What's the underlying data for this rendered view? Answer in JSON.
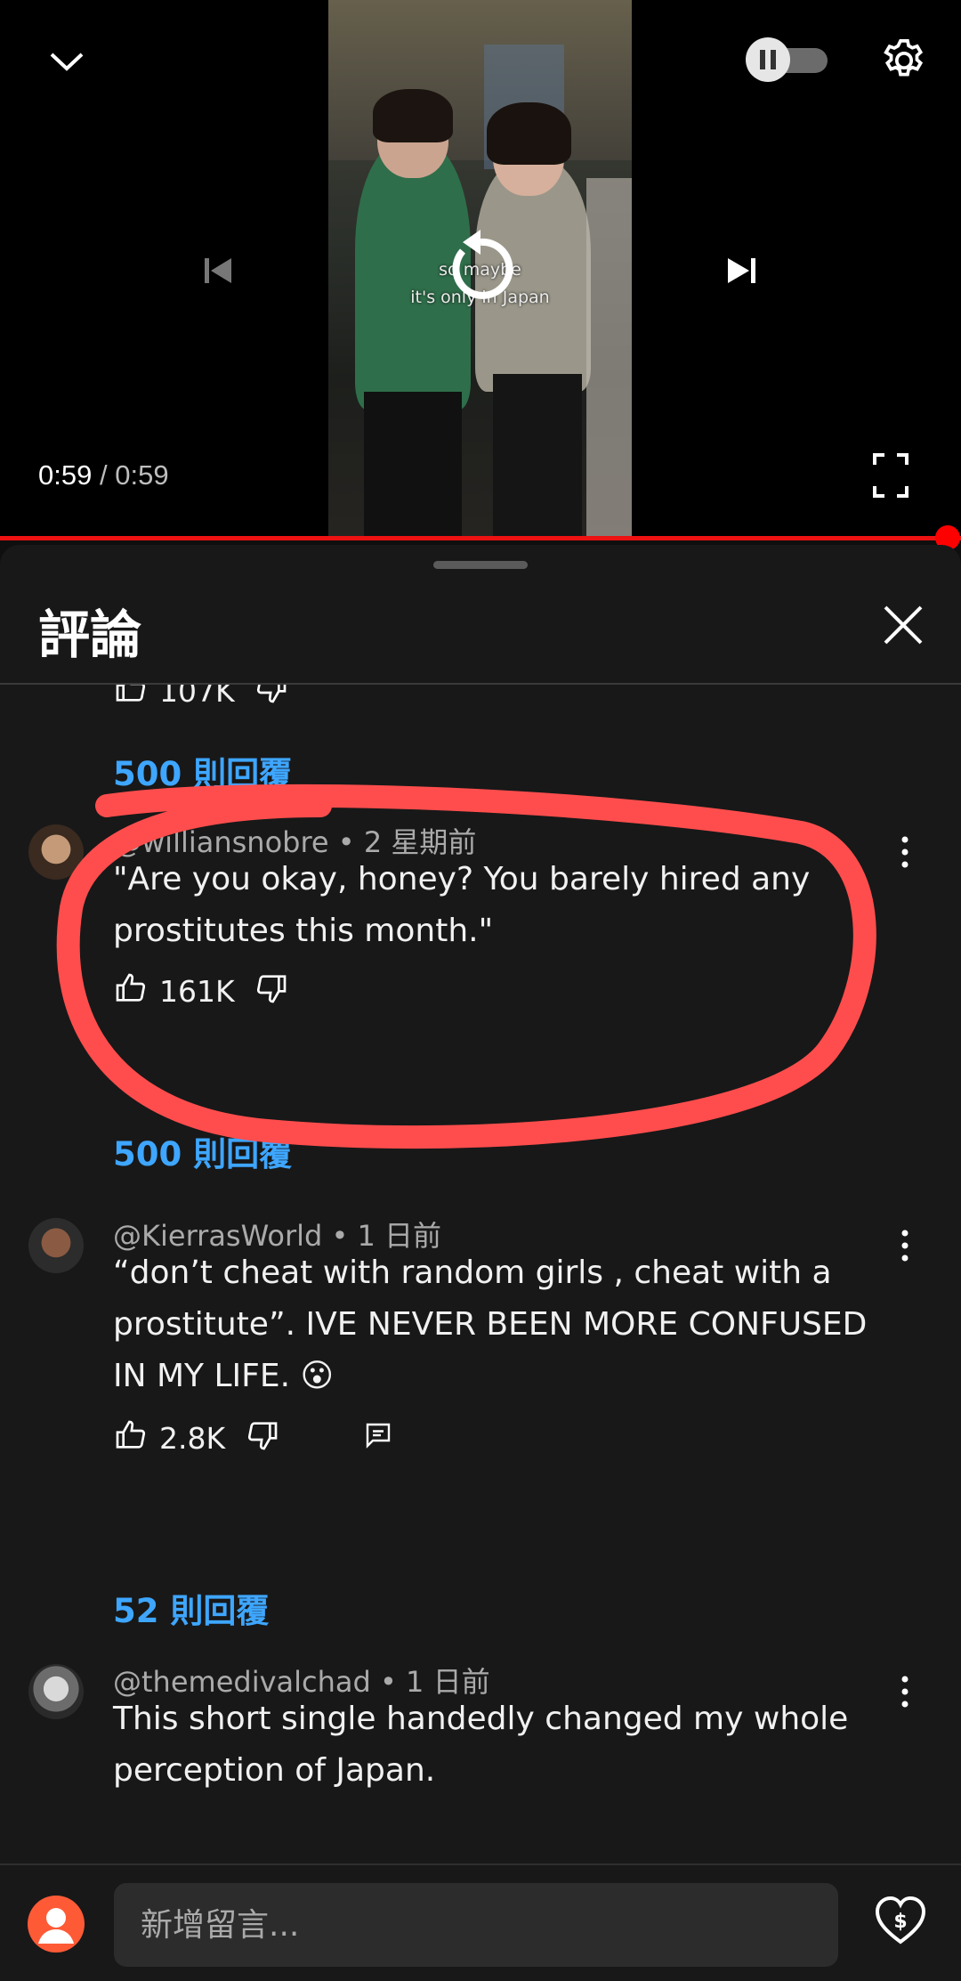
{
  "player": {
    "subtitle_line1": "so maybe",
    "subtitle_line2": "it's only in Japan",
    "current_time": "0:59",
    "separator": "/",
    "duration": "0:59",
    "progress_fraction": 1.0,
    "accent_color": "#ff0000"
  },
  "comments_sheet": {
    "title": "評論",
    "close_icon": "close-icon",
    "partial_top": {
      "likes": "107K"
    },
    "partial_replies": "500 則回覆",
    "comments": [
      {
        "author": "@williansnobre",
        "age": "• 2 星期前",
        "text_line1": "\"Are you okay, honey? You barely hired any",
        "text_line2": "prostitutes this month.\"",
        "likes": "161K",
        "replies": "500 則回覆"
      },
      {
        "author": "@KierrasWorld",
        "age": "• 1 日前",
        "text_line1": "“don’t cheat with random girls , cheat with a",
        "text_line2": "prostitute”. IVE NEVER BEEN MORE CONFUSED",
        "text_line3": "IN MY LIFE. 😮",
        "likes": "2.8K",
        "replies": "52 則回覆"
      },
      {
        "author": "@themedivalchad",
        "age": "• 1 日前",
        "text_line1": "This short single handedly changed my whole",
        "text_line2": "perception of Japan."
      }
    ]
  },
  "input_bar": {
    "placeholder": "新增留言...",
    "thanks_icon": "heart-dollar-icon"
  },
  "annotation": {
    "color": "#ff4d4d",
    "shape": "hand-drawn-circle"
  }
}
